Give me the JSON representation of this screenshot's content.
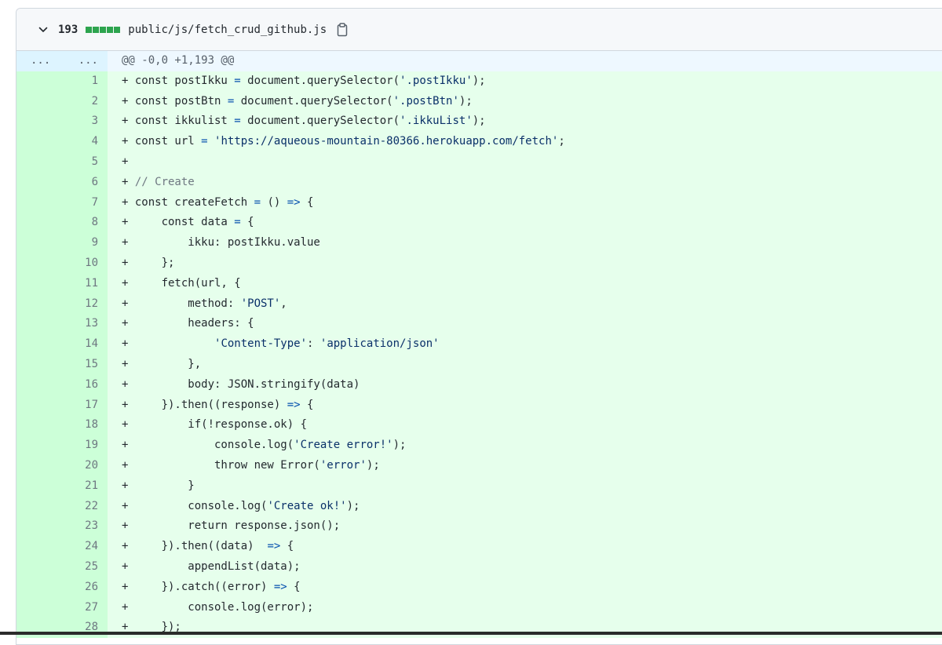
{
  "file": {
    "change_count": "193",
    "path": "public/js/fetch_crud_github.js",
    "diffstat_blocks": 5
  },
  "hunk": {
    "left": "...",
    "right": "...",
    "header": "@@ -0,0 +1,193 @@"
  },
  "lines": [
    {
      "n": "1",
      "code": "+ const postIkku = document.querySelector('.postIkku');"
    },
    {
      "n": "2",
      "code": "+ const postBtn = document.querySelector('.postBtn');"
    },
    {
      "n": "3",
      "code": "+ const ikkulist = document.querySelector('.ikkuList');"
    },
    {
      "n": "4",
      "code": "+ const url = 'https://aqueous-mountain-80366.herokuapp.com/fetch';"
    },
    {
      "n": "5",
      "code": "+"
    },
    {
      "n": "6",
      "code": "+ // Create"
    },
    {
      "n": "7",
      "code": "+ const createFetch = () => {"
    },
    {
      "n": "8",
      "code": "+     const data = {"
    },
    {
      "n": "9",
      "code": "+         ikku: postIkku.value"
    },
    {
      "n": "10",
      "code": "+     };"
    },
    {
      "n": "11",
      "code": "+     fetch(url, {"
    },
    {
      "n": "12",
      "code": "+         method: 'POST',"
    },
    {
      "n": "13",
      "code": "+         headers: {"
    },
    {
      "n": "14",
      "code": "+             'Content-Type': 'application/json'"
    },
    {
      "n": "15",
      "code": "+         },"
    },
    {
      "n": "16",
      "code": "+         body: JSON.stringify(data)"
    },
    {
      "n": "17",
      "code": "+     }).then((response) => {"
    },
    {
      "n": "18",
      "code": "+         if(!response.ok) {"
    },
    {
      "n": "19",
      "code": "+             console.log('Create error!');"
    },
    {
      "n": "20",
      "code": "+             throw new Error('error');"
    },
    {
      "n": "21",
      "code": "+         }"
    },
    {
      "n": "22",
      "code": "+         console.log('Create ok!');"
    },
    {
      "n": "23",
      "code": "+         return response.json();"
    },
    {
      "n": "24",
      "code": "+     }).then((data)  => {"
    },
    {
      "n": "25",
      "code": "+         appendList(data);"
    },
    {
      "n": "26",
      "code": "+     }).catch((error) => {"
    },
    {
      "n": "27",
      "code": "+         console.log(error);"
    },
    {
      "n": "28",
      "code": "+     });"
    }
  ],
  "colors": {
    "added_bg": "#e6ffec",
    "added_gutter": "#ccffd8",
    "hunk_bg": "#ddf4ff",
    "diffstat": "#2da44e"
  },
  "icons": {
    "collapse": "chevron-down-icon",
    "copy": "copy-icon"
  }
}
